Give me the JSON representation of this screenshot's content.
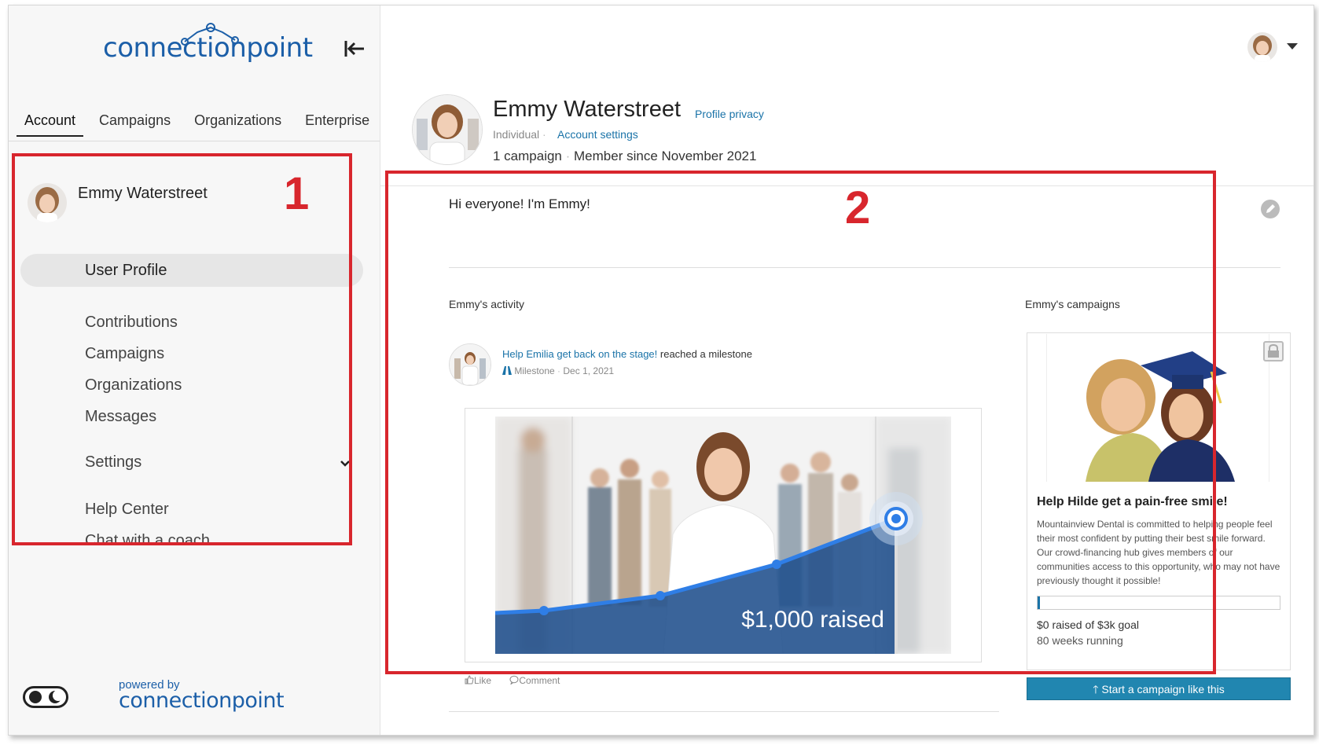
{
  "brand": {
    "logo_text": "connectionpoint",
    "powered_by_label": "powered by",
    "powered_by_logo": "connectionpoint",
    "color": "#1c5fa8"
  },
  "top_tabs": [
    {
      "label": "Account",
      "active": true
    },
    {
      "label": "Campaigns"
    },
    {
      "label": "Organizations"
    },
    {
      "label": "Enterprise"
    }
  ],
  "sidebar": {
    "user_name": "Emmy Waterstreet",
    "active_item": "User Profile",
    "items": {
      "contributions": "Contributions",
      "campaigns": "Campaigns",
      "organizations": "Organizations",
      "messages": "Messages",
      "settings": "Settings",
      "help_center": "Help Center",
      "chat_coach": "Chat with a coach"
    }
  },
  "profile": {
    "name": "Emmy Waterstreet",
    "privacy_link": "Profile privacy",
    "type": "Individual",
    "account_settings_link": "Account settings",
    "campaign_count": "1 campaign",
    "member_since": "Member since November 2021",
    "bio": "Hi everyone! I'm Emmy!"
  },
  "activity": {
    "title": "Emmy's activity",
    "item": {
      "link_text": "Help Emilia get back on the stage!",
      "action_text": " reached a milestone",
      "type": "Milestone",
      "date": "Dec 1, 2021",
      "graphic_caption": "$1,000 raised"
    },
    "like_label": "Like",
    "comment_label": "Comment"
  },
  "campaigns": {
    "title": "Emmy's campaigns",
    "card": {
      "title": "Help Hilde get a pain-free smile!",
      "description": "Mountainview Dental is committed to helping people feel their most confident by putting their best smile forward. Our crowd-financing hub gives members of our communities access to this opportunity, who may not have previously thought it possible!",
      "progress_fraction": 0,
      "raised_text": "$0 raised of $3k goal",
      "weeks_text": "80 weeks running"
    },
    "start_button": "Start a campaign like this"
  },
  "annotations": {
    "box1_label": "1",
    "box2_label": "2",
    "color": "#d8262d"
  }
}
